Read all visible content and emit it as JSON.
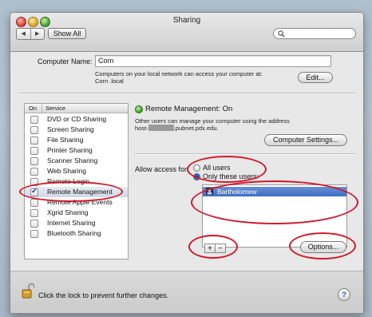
{
  "window": {
    "title": "Sharing",
    "nav": {
      "back": "◀",
      "forward": "▶"
    },
    "show_all": "Show All",
    "search_placeholder": ""
  },
  "computer": {
    "name_label": "Computer Name:",
    "name_value": "Corn",
    "info_line1": "Computers on your local network can access your computer at:",
    "info_line2": "Corn .local",
    "edit_button": "Edit..."
  },
  "services": {
    "header_on": "On",
    "header_service": "Service",
    "items": [
      {
        "label": "DVD or CD Sharing",
        "checked": false
      },
      {
        "label": "Screen Sharing",
        "checked": false
      },
      {
        "label": "File Sharing",
        "checked": false
      },
      {
        "label": "Printer Sharing",
        "checked": false
      },
      {
        "label": "Scanner Sharing",
        "checked": false
      },
      {
        "label": "Web Sharing",
        "checked": false
      },
      {
        "label": "Remote Login",
        "checked": false
      },
      {
        "label": "Remote Management",
        "checked": true
      },
      {
        "label": "Remote Apple Events",
        "checked": false
      },
      {
        "label": "Xgrid Sharing",
        "checked": false
      },
      {
        "label": "Internet Sharing",
        "checked": false
      },
      {
        "label": "Bluetooth Sharing",
        "checked": false
      }
    ]
  },
  "remote_management": {
    "status": "Remote Management: On",
    "desc_line1": "Other users can manage your computer using the address",
    "desc_line2_prefix": "host-",
    "desc_line2_suffix": ".pubnet.pdx.edu.",
    "computer_settings_button": "Computer Settings..."
  },
  "access": {
    "label": "Allow access for:",
    "option_all": "All users",
    "option_only": "Only these users:",
    "selected": "only",
    "users": [
      "Bartholomew"
    ],
    "add_button": "+",
    "remove_button": "−",
    "options_button": "Options..."
  },
  "footer": {
    "lock_text": "Click the lock to prevent further changes.",
    "help": "?"
  },
  "colors": {
    "annotation": "#d0182b",
    "selection": "#3c6ec4",
    "status_green": "#2e9a1c"
  }
}
